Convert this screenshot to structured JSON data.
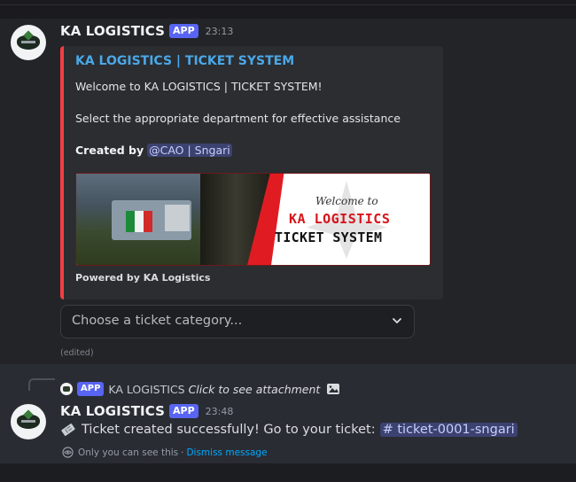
{
  "message1": {
    "username": "KA LOGISTICS",
    "badge": "APP",
    "timestamp": "23:13",
    "embed": {
      "title": "KA LOGISTICS | TICKET SYSTEM",
      "welcome": "Welcome to KA LOGISTICS | TICKET SYSTEM!",
      "instruction": "Select the appropriate department for effective assistance",
      "created_label": "Created by",
      "created_mention": "@CAO | Sngari",
      "image_text": {
        "welcome": "Welcome to",
        "brand": "KA LOGISTICS",
        "subtitle": "TICKET SYSTEM"
      },
      "footer": "Powered by KA Logistics"
    },
    "select_placeholder": "Choose a ticket category...",
    "edited": "(edited)"
  },
  "message2": {
    "reply": {
      "badge": "APP",
      "username": "KA LOGISTICS",
      "text": "Click to see attachment"
    },
    "username": "KA LOGISTICS",
    "badge": "APP",
    "timestamp": "23:48",
    "content": "Ticket created successfully! Go to your ticket:",
    "channel": "# ticket-0001-sngari",
    "ephemeral_text": "Only you can see this",
    "separator": "·",
    "dismiss": "Dismiss message"
  },
  "colors": {
    "embed_accent": "#f23f43",
    "link": "#4aa8e8",
    "badge": "#5865f2",
    "mention_bg": "#3c4270",
    "dismiss_link": "#00a8fc"
  }
}
